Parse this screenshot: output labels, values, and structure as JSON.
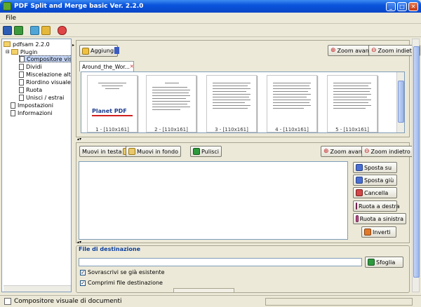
{
  "window": {
    "title": "PDF Split and Merge basic Ver. 2.2.0"
  },
  "menu": {
    "file_label": "File"
  },
  "tree": {
    "root": "pdfsam 2.2.0",
    "plugins": "Plugin",
    "items": [
      "Compositore visuale",
      "Dividi",
      "Miscelazione alternata",
      "Riordino visuale",
      "Ruota",
      "Unisci / estrai"
    ],
    "settings": "Impostazioni",
    "info": "Informazioni"
  },
  "top_panel": {
    "add_label": "Aggiungi",
    "zoom_in_label": "Zoom avanti",
    "zoom_out_label": "Zoom indietro",
    "tab_label": "Around_the_Wor...",
    "thumbnail_labels": [
      "1 - [110x161]",
      "2 - [110x161]",
      "3 - [110x161]",
      "4 - [110x161]",
      "5 - [110x161]"
    ],
    "first_page_text": "Planet PDF"
  },
  "bottom_panel": {
    "move_top_label": "Muovi in testa",
    "move_bottom_label": "Muovi in fondo",
    "clear_label": "Pulisci",
    "zoom_in_label": "Zoom avanti",
    "zoom_out_label": "Zoom indietro",
    "move_up_label": "Sposta su",
    "move_down_label": "Sposta giù",
    "delete_label": "Cancella",
    "rotate_right_label": "Ruota a destra",
    "rotate_left_label": "Ruota a sinistra",
    "invert_label": "Inverti"
  },
  "destination": {
    "section_label": "File di destinazione",
    "path_value": "",
    "browse_label": "Sfoglia",
    "overwrite_label": "Sovrascrivi se già esistente",
    "compress_label": "Comprimi file destinazione",
    "overwrite_checked": true,
    "compress_checked": true
  },
  "status": {
    "text": "Compositore visuale di documenti"
  }
}
